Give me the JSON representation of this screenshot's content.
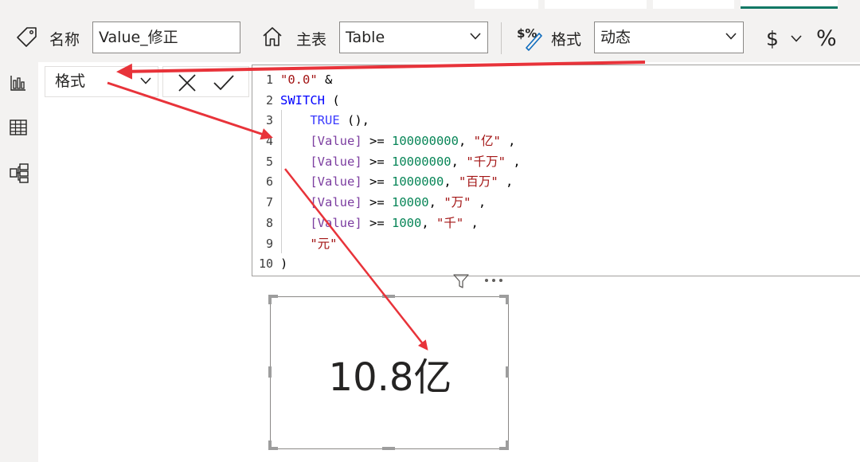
{
  "ribbon": {
    "name_label": "名称",
    "name_value": "Value_修正",
    "home_table_label": "主表",
    "home_table_value": "Table",
    "format_label": "格式",
    "format_value": "动态",
    "currency_symbol": "$",
    "percent_symbol": "%"
  },
  "formula_bar": {
    "property": "格式"
  },
  "editor": {
    "lines": [
      {
        "n": "1",
        "tokens": [
          {
            "t": "\"0.0\"",
            "c": "str"
          },
          {
            "t": " &",
            "c": ""
          }
        ]
      },
      {
        "n": "2",
        "tokens": [
          {
            "t": "SWITCH",
            "c": "kw"
          },
          {
            "t": " (",
            "c": ""
          }
        ]
      },
      {
        "n": "3",
        "tokens": [
          {
            "t": "    ",
            "c": ""
          },
          {
            "t": "TRUE",
            "c": "fn"
          },
          {
            "t": " (),",
            "c": ""
          }
        ]
      },
      {
        "n": "4",
        "tokens": [
          {
            "t": "    ",
            "c": ""
          },
          {
            "t": "[Value]",
            "c": "col"
          },
          {
            "t": " >= ",
            "c": ""
          },
          {
            "t": "100000000",
            "c": "num"
          },
          {
            "t": ", ",
            "c": ""
          },
          {
            "t": "\"亿\"",
            "c": "str"
          },
          {
            "t": " ,",
            "c": ""
          }
        ]
      },
      {
        "n": "5",
        "tokens": [
          {
            "t": "    ",
            "c": ""
          },
          {
            "t": "[Value]",
            "c": "col"
          },
          {
            "t": " >= ",
            "c": ""
          },
          {
            "t": "10000000",
            "c": "num"
          },
          {
            "t": ", ",
            "c": ""
          },
          {
            "t": "\"千万\"",
            "c": "str"
          },
          {
            "t": " ,",
            "c": ""
          }
        ]
      },
      {
        "n": "6",
        "tokens": [
          {
            "t": "    ",
            "c": ""
          },
          {
            "t": "[Value]",
            "c": "col"
          },
          {
            "t": " >= ",
            "c": ""
          },
          {
            "t": "1000000",
            "c": "num"
          },
          {
            "t": ", ",
            "c": ""
          },
          {
            "t": "\"百万\"",
            "c": "str"
          },
          {
            "t": " ,",
            "c": ""
          }
        ]
      },
      {
        "n": "7",
        "tokens": [
          {
            "t": "    ",
            "c": ""
          },
          {
            "t": "[Value]",
            "c": "col"
          },
          {
            "t": " >= ",
            "c": ""
          },
          {
            "t": "10000",
            "c": "num"
          },
          {
            "t": ", ",
            "c": ""
          },
          {
            "t": "\"万\"",
            "c": "str"
          },
          {
            "t": " ,",
            "c": ""
          }
        ]
      },
      {
        "n": "8",
        "tokens": [
          {
            "t": "    ",
            "c": ""
          },
          {
            "t": "[Value]",
            "c": "col"
          },
          {
            "t": " >= ",
            "c": ""
          },
          {
            "t": "1000",
            "c": "num"
          },
          {
            "t": ", ",
            "c": ""
          },
          {
            "t": "\"千\"",
            "c": "str"
          },
          {
            "t": " ,",
            "c": ""
          }
        ]
      },
      {
        "n": "9",
        "tokens": [
          {
            "t": "    ",
            "c": ""
          },
          {
            "t": "\"元\"",
            "c": "str"
          }
        ]
      },
      {
        "n": "10",
        "tokens": [
          {
            "t": ")",
            "c": ""
          }
        ]
      }
    ]
  },
  "card": {
    "value": "10.8亿"
  },
  "colors": {
    "accent": "#117865",
    "arrow": "#e8333a",
    "string": "#a31515",
    "keyword": "#0000ff",
    "column": "#7c3ea0",
    "number": "#098658"
  },
  "icons": {
    "tag": "tag-icon",
    "home": "home-icon",
    "format": "dollar-percent-icon",
    "report_view": "bar-chart-icon",
    "data_view": "table-grid-icon",
    "model_view": "model-icon",
    "cancel": "close-icon",
    "confirm": "checkmark-icon",
    "filter": "filter-icon",
    "more": "more-options-icon"
  }
}
